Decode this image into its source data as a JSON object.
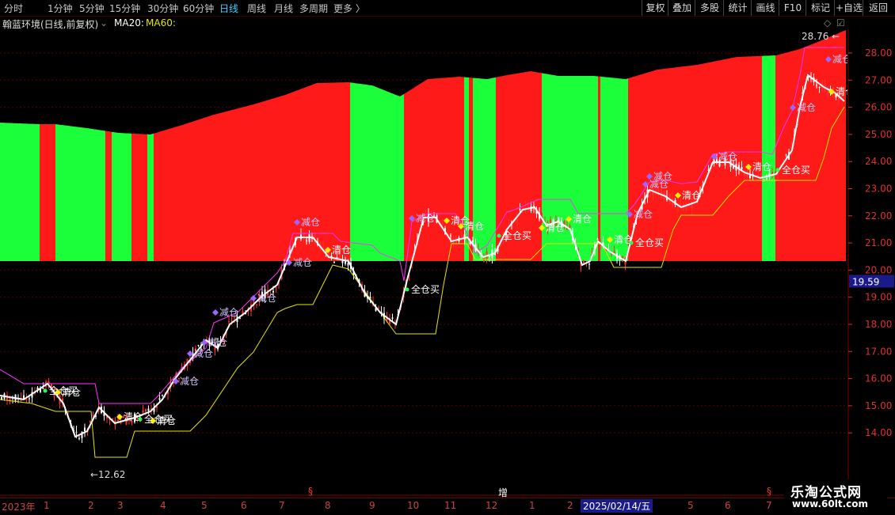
{
  "toolbar": {
    "periods": [
      "分时",
      "1分钟",
      "5分钟",
      "15分钟",
      "30分钟",
      "60分钟",
      "日线",
      "周线",
      "月线",
      "多周期",
      "更多 〉"
    ],
    "active_period": "日线",
    "right_buttons": [
      "复权",
      "叠加",
      "多股",
      "统计",
      "画线",
      "F10",
      "标记",
      "+自选",
      "返回"
    ]
  },
  "info": {
    "title": "翰蓝环境(日线,前复权)",
    "ma20": "MA20:",
    "ma60": "MA60:"
  },
  "price_axis": {
    "labels": [
      "28.00",
      "27.00",
      "26.00",
      "25.00",
      "24.00",
      "23.00",
      "22.00",
      "21.00",
      "20.00",
      "19.00",
      "18.00",
      "17.00",
      "16.00",
      "15.00",
      "14.00"
    ],
    "current_price": "19.59"
  },
  "markers": {
    "high": "28.76",
    "low": "12.62",
    "bottom_mid": "增",
    "s_marks": [
      "§",
      "§"
    ]
  },
  "bottom_bar": {
    "year": "2023年",
    "months": [
      "1",
      "2",
      "3",
      "4",
      "5",
      "6",
      "7",
      "8",
      "9",
      "10",
      "11",
      "12",
      "1",
      "2",
      "4",
      "5",
      "6",
      "7"
    ],
    "cursor_date": "2025/02/14/五"
  },
  "watermark": {
    "line1": "乐淘公式网",
    "line2": "www.60lt.com"
  },
  "signals": [
    "减仓",
    "清仓",
    "全仓买"
  ],
  "colors": {
    "red_band": "#ff1a1a",
    "green_band": "#1aff3a",
    "pink_line": "#ff33ff",
    "yellow_line": "#e6e600",
    "white_line": "#ffffff",
    "sell_diamond": "#9966ff",
    "clear_diamond": "#ffee00",
    "buy_dot": "#22ff55",
    "active_tab": "#3ad0ff"
  }
}
